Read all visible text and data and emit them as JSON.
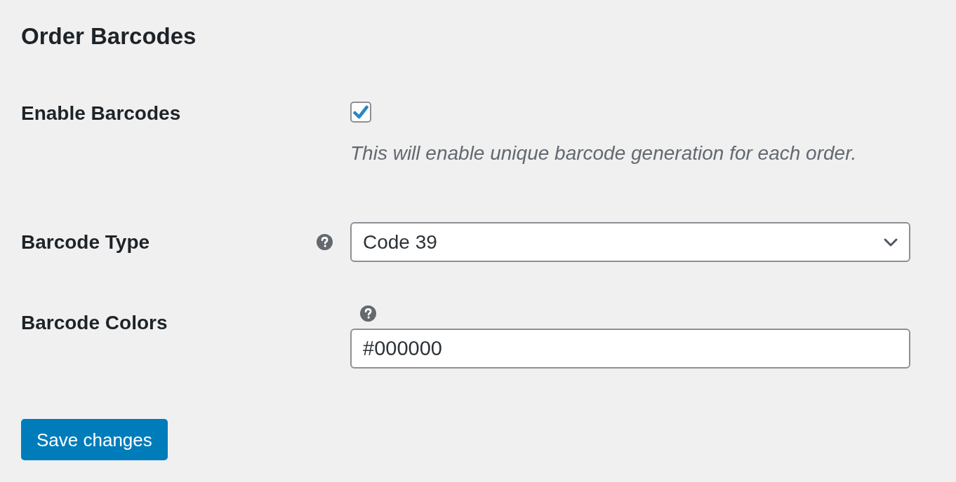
{
  "title": "Order Barcodes",
  "fields": [
    {
      "kind": "checkbox",
      "label": "Enable Barcodes",
      "help": false,
      "checked": true,
      "description": "This will enable unique barcode generation for each order."
    },
    {
      "kind": "select",
      "label": "Barcode Type",
      "help": true,
      "value": "Code 39"
    },
    {
      "kind": "text",
      "label": "Barcode Colors",
      "help": true,
      "value": "#000000"
    }
  ],
  "buttons": [
    {
      "label": "Save changes"
    }
  ]
}
